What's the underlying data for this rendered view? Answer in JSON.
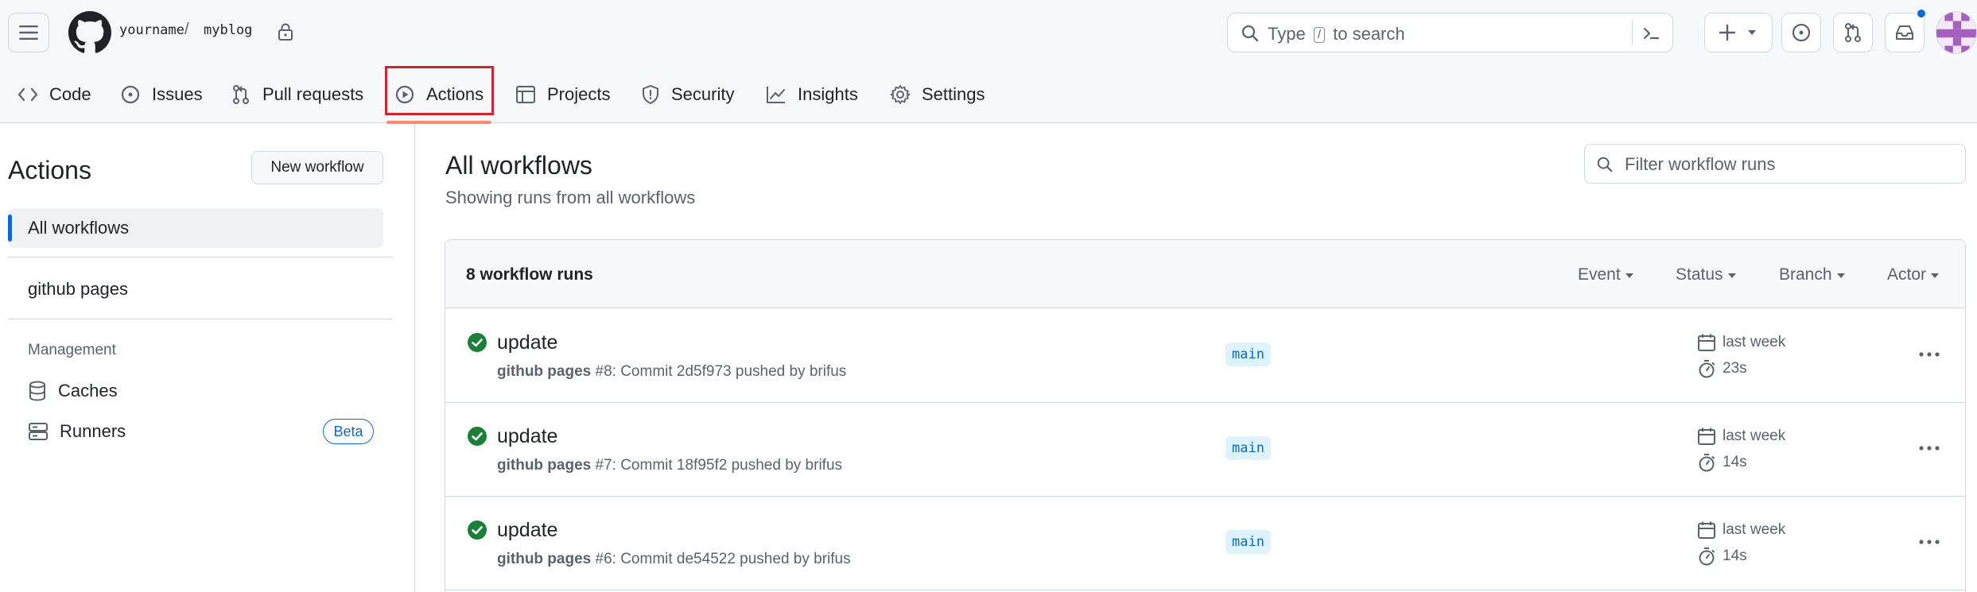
{
  "header": {
    "repo_owner": "yourname",
    "repo_slash": "/",
    "repo_name": "myblog",
    "search_prefix": "Type",
    "search_key": "/",
    "search_suffix": "to search",
    "notification_color": "#0969da"
  },
  "tabs": [
    {
      "label": "Code",
      "icon": "code-icon"
    },
    {
      "label": "Issues",
      "icon": "issue-opened-icon"
    },
    {
      "label": "Pull requests",
      "icon": "git-pull-request-icon"
    },
    {
      "label": "Actions",
      "icon": "play-icon",
      "selected": true
    },
    {
      "label": "Projects",
      "icon": "table-icon"
    },
    {
      "label": "Security",
      "icon": "shield-icon"
    },
    {
      "label": "Insights",
      "icon": "graph-icon"
    },
    {
      "label": "Settings",
      "icon": "gear-icon"
    }
  ],
  "sidebar": {
    "title": "Actions",
    "new_workflow": "New workflow",
    "all_workflows": "All workflows",
    "workflows": [
      "github pages"
    ],
    "management_heading": "Management",
    "caches": "Caches",
    "runners": "Runners",
    "beta": "Beta"
  },
  "main": {
    "title": "All workflows",
    "subtitle": "Showing runs from all workflows",
    "filter_placeholder": "Filter workflow runs",
    "runs_count": "8 workflow runs",
    "filters": {
      "event": "Event",
      "status": "Status",
      "branch": "Branch",
      "actor": "Actor"
    },
    "runs": [
      {
        "title": "update",
        "workflow": "github pages",
        "meta": "#8: Commit 2d5f973 pushed by brifus",
        "branch": "main",
        "when": "last week",
        "duration": "23s",
        "status": "success"
      },
      {
        "title": "update",
        "workflow": "github pages",
        "meta": "#7: Commit 18f95f2 pushed by brifus",
        "branch": "main",
        "when": "last week",
        "duration": "14s",
        "status": "success"
      },
      {
        "title": "update",
        "workflow": "github pages",
        "meta": "#6: Commit de54522 pushed by brifus",
        "branch": "main",
        "when": "last week",
        "duration": "14s",
        "status": "success"
      }
    ]
  },
  "colors": {
    "accent": "#0969da",
    "success": "#1a7f37",
    "selected_underline": "#fd8c73",
    "highlight_box": "#d1242f"
  }
}
